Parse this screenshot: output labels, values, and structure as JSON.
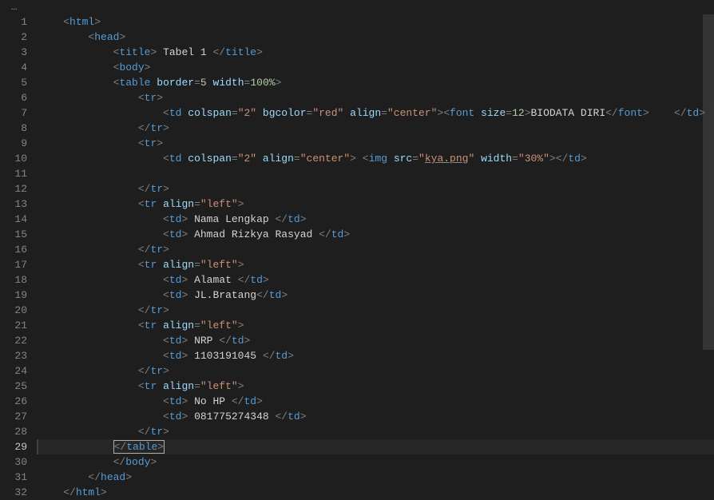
{
  "lineNumbers": [
    "1",
    "2",
    "3",
    "4",
    "5",
    "6",
    "7",
    "8",
    "9",
    "10",
    "11",
    "12",
    "13",
    "14",
    "15",
    "16",
    "17",
    "18",
    "19",
    "20",
    "21",
    "22",
    "23",
    "24",
    "25",
    "26",
    "27",
    "28",
    "29",
    "30",
    "31",
    "32"
  ],
  "activeLine": "29",
  "code": {
    "line3_title": " Tabel 1 ",
    "line5_border_attr": "border",
    "line5_border_val": "5",
    "line5_width_attr": "width",
    "line5_width_val": "100%",
    "line7_colspan_attr": "colspan",
    "line7_colspan_val": "\"2\"",
    "line7_bgcolor_attr": "bgcolor",
    "line7_bgcolor_val": "\"red\"",
    "line7_align_attr": "align",
    "line7_align_val": "\"center\"",
    "line7_size_attr": "size",
    "line7_size_val": "12",
    "line7_text": "BIODATA DIRI",
    "line10_colspan_attr": "colspan",
    "line10_colspan_val": "\"2\"",
    "line10_align_attr": "align",
    "line10_align_val": "\"center\"",
    "line10_src_attr": "src",
    "line10_src_val": "kya.png",
    "line10_width_attr": "width",
    "line10_width_val": "\"30%\"",
    "line13_align_attr": "align",
    "line13_align_val": "\"left\"",
    "line14_text": " Nama Lengkap ",
    "line15_text": " Ahmad Rizkya Rasyad ",
    "line17_align_attr": "align",
    "line17_align_val": "\"left\"",
    "line18_text": " Alamat ",
    "line19_text": " JL.Bratang",
    "line21_align_attr": "align",
    "line21_align_val": "\"left\"",
    "line22_text": " NRP ",
    "line23_text": " 1103191045 ",
    "line25_align_attr": "align",
    "line25_align_val": "\"left\"",
    "line26_text": " No HP ",
    "line27_text": " 081775274348 "
  }
}
